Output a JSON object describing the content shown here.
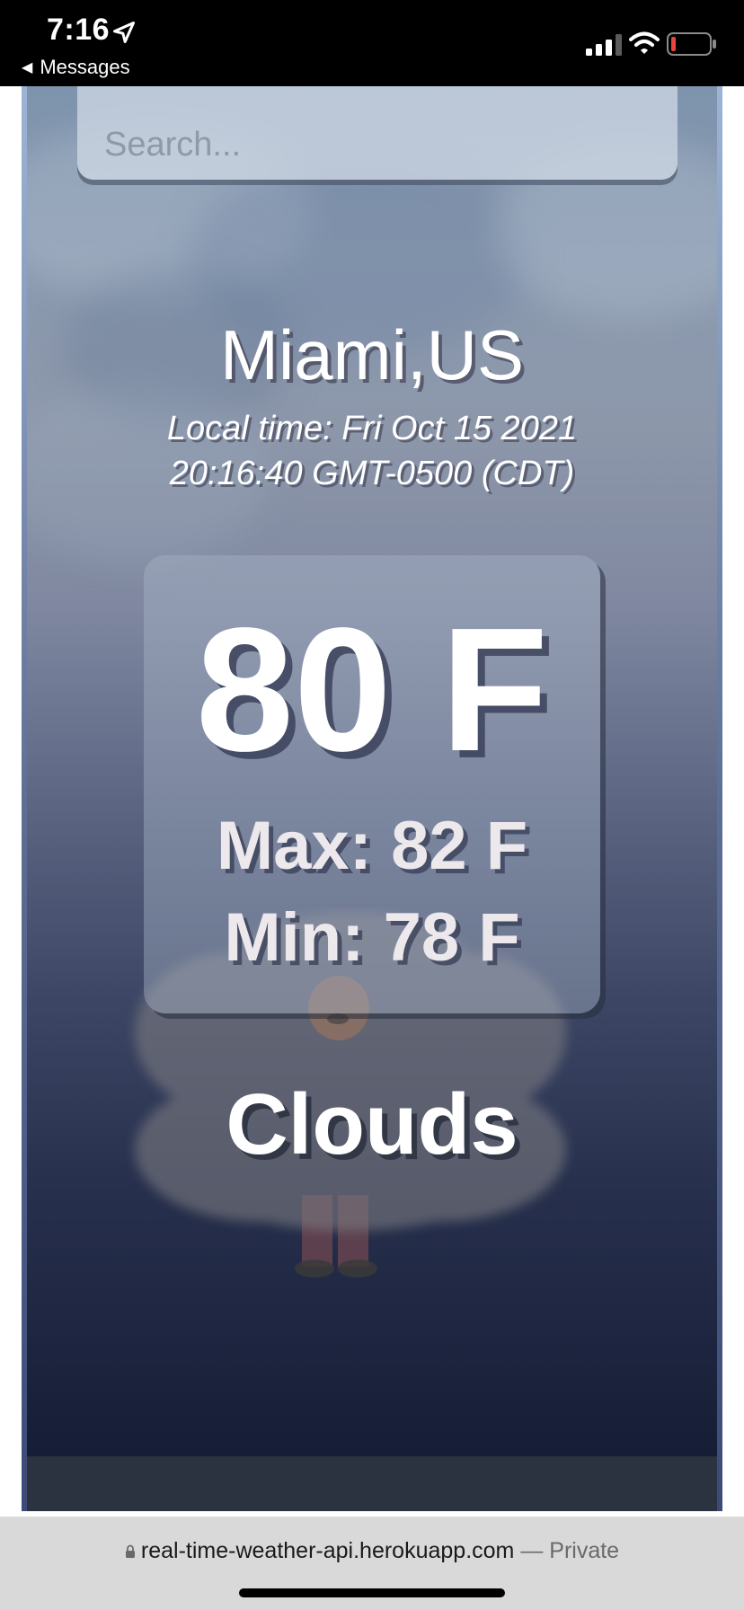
{
  "status_bar": {
    "time": "7:16",
    "back_label": "Messages"
  },
  "search": {
    "placeholder": "Search..."
  },
  "weather": {
    "city": "Miami,US",
    "local_time_line1": "Local time: Fri Oct 15 2021",
    "local_time_line2": "20:16:40 GMT-0500 (CDT)",
    "temperature": "80 F",
    "max": "Max: 82 F",
    "min": "Min: 78 F",
    "condition": "Clouds"
  },
  "browser": {
    "url": "real-time-weather-api.herokuapp.com",
    "separator": " — ",
    "mode": "Private"
  },
  "colors": {
    "status_bar_bg": "#000000",
    "battery_low": "#e8453c",
    "card_text": "#ece8ec"
  },
  "icons": [
    "location-arrow-icon",
    "back-triangle-icon",
    "signal-icon",
    "wifi-icon",
    "battery-icon",
    "lock-icon"
  ]
}
